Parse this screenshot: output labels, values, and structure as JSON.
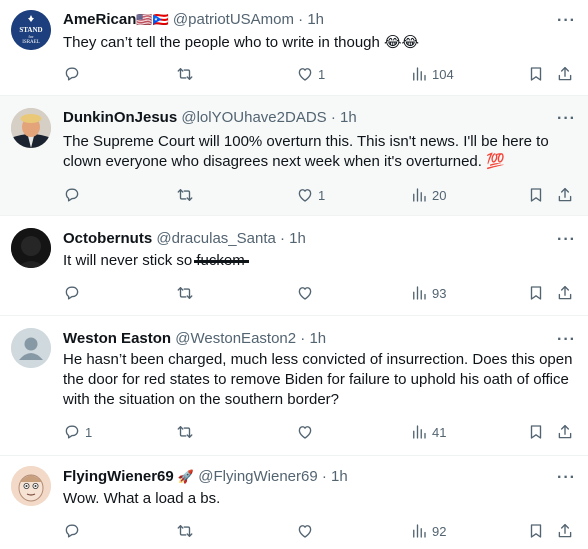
{
  "tweets": [
    {
      "name": "AmeRican",
      "name_flags": "🇺🇸🇵🇷",
      "handle": "@patriotUSAmom",
      "time": "1h",
      "text": "They can’t tell the people who to write in though 😂😂",
      "avatar_text": "STAND for ISRAEL",
      "replies": "",
      "retweets": "",
      "likes": "1",
      "views": "104"
    },
    {
      "name": "DunkinOnJesus",
      "handle": "@lolYOUhave2DADS",
      "time": "1h",
      "text": "The Supreme Court will 100% overturn this. This isn't news. I'll be here to clown everyone who disagrees next week when it's overturned. 💯",
      "replies": "",
      "retweets": "",
      "likes": "1",
      "views": "20"
    },
    {
      "name": "Octobernuts",
      "handle": "@draculas_Santa",
      "time": "1h",
      "text_main": "It will never stick so ",
      "text_struck": "fuckem",
      "replies": "",
      "retweets": "",
      "likes": "",
      "views": "93"
    },
    {
      "name": "Weston Easton",
      "handle": "@WestonEaston2",
      "time": "1h",
      "text": "He hasn’t been charged, much less convicted of insurrection.  Does this open the door for red states to remove Biden for failure to uphold his oath of office with the situation on the southern border?",
      "replies": "1",
      "retweets": "",
      "likes": "",
      "views": "41"
    },
    {
      "name": "FlyingWiener69",
      "name_emoji": "🚀",
      "handle": "@FlyingWiener69",
      "time": "1h",
      "text": "Wow. What a load a bs.",
      "replies": "",
      "retweets": "",
      "likes": "",
      "views": "92"
    }
  ],
  "separator": "·",
  "more_label": "···",
  "colors": {
    "text": "#0f1419",
    "secondary": "#536471",
    "divider": "#eff3f4",
    "highlight_bg": "#f7f9f9"
  },
  "icons": [
    "reply-icon",
    "retweet-icon",
    "like-icon",
    "views-icon",
    "bookmark-icon",
    "share-icon"
  ]
}
